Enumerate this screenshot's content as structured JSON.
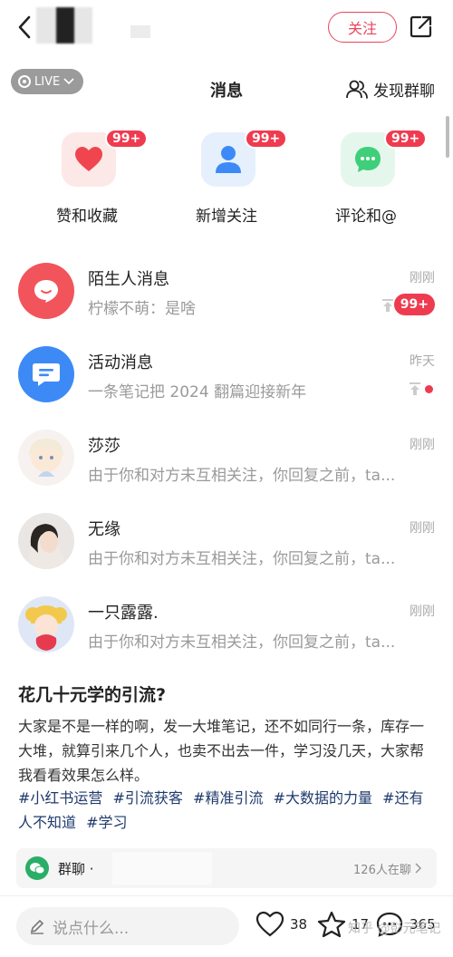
{
  "header": {
    "follow_label": "关注"
  },
  "messages": {
    "live_label": "LIVE",
    "title": "消息",
    "discover_label": "发现群聊"
  },
  "tiles": [
    {
      "label": "赞和收藏",
      "badge": "99+",
      "icon": "heart-icon",
      "color": "#f0454f",
      "bg": "#fde8e8"
    },
    {
      "label": "新增关注",
      "badge": "99+",
      "icon": "person-icon",
      "color": "#3d8af7",
      "bg": "#e6f0fd"
    },
    {
      "label": "评论和@",
      "badge": "99+",
      "icon": "chat-icon",
      "color": "#3fcf7a",
      "bg": "#e5f7ec"
    }
  ],
  "conversations": [
    {
      "name": "陌生人消息",
      "preview": "柠檬不萌：是啥",
      "time": "刚刚",
      "badge": "99+"
    },
    {
      "name": "活动消息",
      "preview": "一条笔记把 2024 翻篇迎接新年",
      "time": "昨天"
    },
    {
      "name": "莎莎",
      "preview": "由于你和对方未互相关注，你回复之前，ta...",
      "time": "刚刚"
    },
    {
      "name": "无缘",
      "preview": "由于你和对方未互相关注，你回复之前，ta...",
      "time": "刚刚"
    },
    {
      "name": "一只露露.",
      "preview": "由于你和对方未互相关注，你回复之前，ta...",
      "time": "刚刚"
    }
  ],
  "post": {
    "title": "花几十元学的引流?",
    "body": "大家是不是一样的啊，发一大堆笔记，还不如同行一条，库存一大堆，就算引来几个人，也卖不出去一件，学习没几天，大家帮我看看效果怎么样。",
    "tags": [
      "#小红书运营",
      "#引流获客",
      "#精准引流",
      "#大数据的力量",
      "#还有人不知道",
      "#学习"
    ]
  },
  "group": {
    "label": "群聊 ·",
    "count": "126人在聊"
  },
  "bottom": {
    "input_placeholder": "说点什么...",
    "likes": "38",
    "stars": "17",
    "comments": "365",
    "watermark": "知乎 @彭元笔记"
  }
}
